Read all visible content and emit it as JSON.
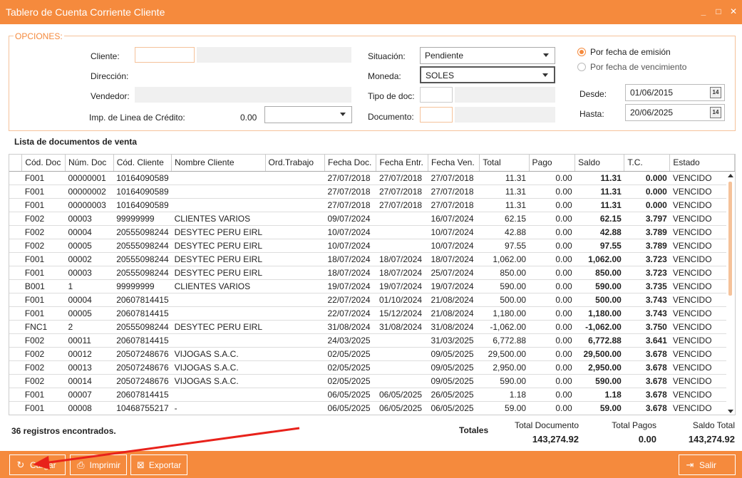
{
  "window": {
    "title": "Tablero de Cuenta Corriente Cliente",
    "controls": [
      "_",
      "□",
      "✕"
    ]
  },
  "options": {
    "legend": "OPCIONES:",
    "cliente_label": "Cliente:",
    "direccion_label": "Dirección:",
    "vendedor_label": "Vendedor:",
    "credito_label": "Imp. de Linea de Crédito:",
    "credito_value": "0.00",
    "situacion_label": "Situación:",
    "situacion_value": "Pendiente",
    "moneda_label": "Moneda:",
    "moneda_value": "SOLES",
    "tipodoc_label": "Tipo de doc:",
    "documento_label": "Documento:",
    "radio_emision": "Por fecha de emisión",
    "radio_vencimiento": "Por fecha de vencimiento",
    "desde_label": "Desde:",
    "desde_value": "01/06/2015",
    "hasta_label": "Hasta:",
    "hasta_value": "20/06/2025",
    "calendar_glyph": "14"
  },
  "list": {
    "title": "Lista de documentos de venta",
    "columns": [
      "Cód. Doc",
      "Núm. Doc",
      "Cód. Cliente",
      "Nombre Cliente",
      "Ord.Trabajo",
      "Fecha Doc.",
      "Fecha Entr.",
      "Fecha Ven.",
      "Total",
      "Pago",
      "Saldo",
      "T.C.",
      "Estado"
    ],
    "rows": [
      [
        "F001",
        "00000001",
        "10164090589",
        "",
        "",
        "27/07/2018",
        "27/07/2018",
        "27/07/2018",
        "11.31",
        "0.00",
        "11.31",
        "0.000",
        "VENCIDO"
      ],
      [
        "F001",
        "00000002",
        "10164090589",
        "",
        "",
        "27/07/2018",
        "27/07/2018",
        "27/07/2018",
        "11.31",
        "0.00",
        "11.31",
        "0.000",
        "VENCIDO"
      ],
      [
        "F001",
        "00000003",
        "10164090589",
        "",
        "",
        "27/07/2018",
        "27/07/2018",
        "27/07/2018",
        "11.31",
        "0.00",
        "11.31",
        "0.000",
        "VENCIDO"
      ],
      [
        "F002",
        "00003",
        "99999999",
        "CLIENTES VARIOS",
        "",
        "09/07/2024",
        "",
        "16/07/2024",
        "62.15",
        "0.00",
        "62.15",
        "3.797",
        "VENCIDO"
      ],
      [
        "F002",
        "00004",
        "20555098244",
        "DESYTEC PERU EIRL",
        "",
        "10/07/2024",
        "",
        "10/07/2024",
        "42.88",
        "0.00",
        "42.88",
        "3.789",
        "VENCIDO"
      ],
      [
        "F002",
        "00005",
        "20555098244",
        "DESYTEC PERU EIRL",
        "",
        "10/07/2024",
        "",
        "10/07/2024",
        "97.55",
        "0.00",
        "97.55",
        "3.789",
        "VENCIDO"
      ],
      [
        "F001",
        "00002",
        "20555098244",
        "DESYTEC PERU EIRL",
        "",
        "18/07/2024",
        "18/07/2024",
        "18/07/2024",
        "1,062.00",
        "0.00",
        "1,062.00",
        "3.723",
        "VENCIDO"
      ],
      [
        "F001",
        "00003",
        "20555098244",
        "DESYTEC PERU EIRL",
        "",
        "18/07/2024",
        "18/07/2024",
        "25/07/2024",
        "850.00",
        "0.00",
        "850.00",
        "3.723",
        "VENCIDO"
      ],
      [
        "B001",
        "1",
        "99999999",
        "CLIENTES VARIOS",
        "",
        "19/07/2024",
        "19/07/2024",
        "19/07/2024",
        "590.00",
        "0.00",
        "590.00",
        "3.735",
        "VENCIDO"
      ],
      [
        "F001",
        "00004",
        "20607814415",
        "",
        "",
        "22/07/2024",
        "01/10/2024",
        "21/08/2024",
        "500.00",
        "0.00",
        "500.00",
        "3.743",
        "VENCIDO"
      ],
      [
        "F001",
        "00005",
        "20607814415",
        "",
        "",
        "22/07/2024",
        "15/12/2024",
        "21/08/2024",
        "1,180.00",
        "0.00",
        "1,180.00",
        "3.743",
        "VENCIDO"
      ],
      [
        "FNC1",
        "2",
        "20555098244",
        "DESYTEC PERU EIRL",
        "",
        "31/08/2024",
        "31/08/2024",
        "31/08/2024",
        "-1,062.00",
        "0.00",
        "-1,062.00",
        "3.750",
        "VENCIDO"
      ],
      [
        "F002",
        "00011",
        "20607814415",
        "",
        "",
        "24/03/2025",
        "",
        "31/03/2025",
        "6,772.88",
        "0.00",
        "6,772.88",
        "3.641",
        "VENCIDO"
      ],
      [
        "F002",
        "00012",
        "20507248676",
        "VIJOGAS S.A.C.",
        "",
        "02/05/2025",
        "",
        "09/05/2025",
        "29,500.00",
        "0.00",
        "29,500.00",
        "3.678",
        "VENCIDO"
      ],
      [
        "F002",
        "00013",
        "20507248676",
        "VIJOGAS S.A.C.",
        "",
        "02/05/2025",
        "",
        "09/05/2025",
        "2,950.00",
        "0.00",
        "2,950.00",
        "3.678",
        "VENCIDO"
      ],
      [
        "F002",
        "00014",
        "20507248676",
        "VIJOGAS S.A.C.",
        "",
        "02/05/2025",
        "",
        "09/05/2025",
        "590.00",
        "0.00",
        "590.00",
        "3.678",
        "VENCIDO"
      ],
      [
        "F001",
        "00007",
        "20607814415",
        "",
        "",
        "06/05/2025",
        "06/05/2025",
        "26/05/2025",
        "1.18",
        "0.00",
        "1.18",
        "3.678",
        "VENCIDO"
      ],
      [
        "F001",
        "00008",
        "10468755217",
        "-",
        "",
        "06/05/2025",
        "06/05/2025",
        "06/05/2025",
        "59.00",
        "0.00",
        "59.00",
        "3.678",
        "VENCIDO"
      ]
    ]
  },
  "summary": {
    "found": "36 registros encontrados.",
    "totales_label": "Totales",
    "total_documento_label": "Total Documento",
    "total_documento_value": "143,274.92",
    "total_pagos_label": "Total Pagos",
    "total_pagos_value": "0.00",
    "saldo_total_label": "Saldo Total",
    "saldo_total_value": "143,274.92"
  },
  "toolbar": {
    "cargar": "Cargar",
    "imprimir": "Imprimir",
    "exportar": "Exportar",
    "salir": "Salir"
  },
  "colors": {
    "accent": "#f58a3d",
    "annotation_arrow": "#e8221b"
  }
}
